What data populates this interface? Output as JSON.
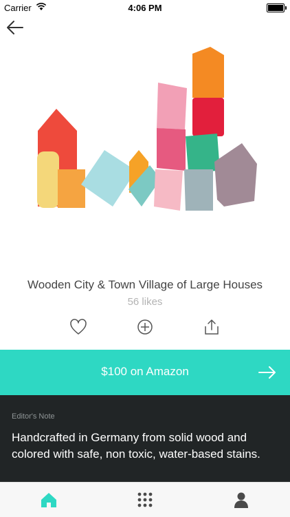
{
  "status_bar": {
    "carrier": "Carrier",
    "time": "4:06 PM"
  },
  "product": {
    "title": "Wooden City & Town Village of Large Houses",
    "likes": "56 likes"
  },
  "actions": [
    "heart-icon",
    "add-icon",
    "share-icon"
  ],
  "buy": {
    "label": "$100 on Amazon"
  },
  "editor_note": {
    "heading": "Editor's Note",
    "body": "Handcrafted in Germany from solid wood and colored with safe, non toxic, water-based stains."
  },
  "tabs": [
    "home-icon",
    "grid-icon",
    "profile-icon"
  ],
  "colors": {
    "accent": "#2ed8c3",
    "note_background": "#212526",
    "tab_active": "#2ed8c3",
    "tab_inactive": "#4a4a4a"
  }
}
